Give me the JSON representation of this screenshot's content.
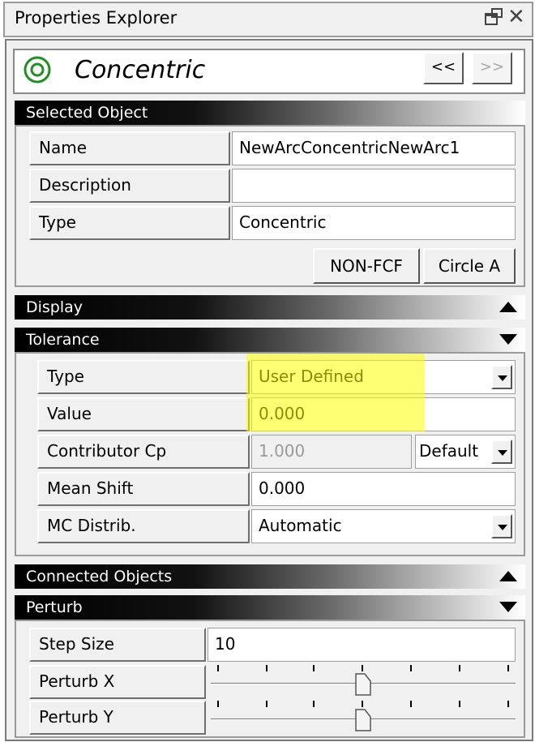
{
  "window": {
    "title": "Properties Explorer"
  },
  "header": {
    "object_title": "Concentric",
    "prev_label": "<<",
    "next_label": ">>"
  },
  "selected_object": {
    "section_label": "Selected Object",
    "rows": [
      {
        "label": "Name",
        "value": "NewArcConcentricNewArc1"
      },
      {
        "label": "Description",
        "value": ""
      },
      {
        "label": "Type",
        "value": "Concentric"
      }
    ],
    "buttons": {
      "non_fcf": "NON-FCF",
      "circle_a": "Circle A"
    }
  },
  "display": {
    "section_label": "Display"
  },
  "tolerance": {
    "section_label": "Tolerance",
    "type": {
      "label": "Type",
      "value": "User Defined"
    },
    "value": {
      "label": "Value",
      "value": "0.000"
    },
    "contributor_cp": {
      "label": "Contributor Cp",
      "value": "1.000",
      "mode": "Default"
    },
    "mean_shift": {
      "label": "Mean Shift",
      "value": "0.000"
    },
    "mc_distrib": {
      "label": "MC Distrib.",
      "value": "Automatic"
    }
  },
  "connected_objects": {
    "section_label": "Connected Objects"
  },
  "perturb": {
    "section_label": "Perturb",
    "step_size": {
      "label": "Step Size",
      "value": "10"
    },
    "perturb_x": {
      "label": "Perturb X"
    },
    "perturb_y": {
      "label": "Perturb Y"
    }
  },
  "colors": {
    "highlight": "#ffff00",
    "accent_icon": "#1f8f1f"
  }
}
